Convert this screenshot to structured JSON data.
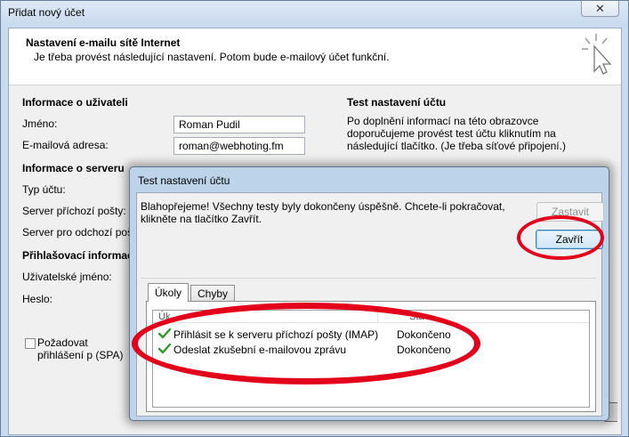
{
  "window": {
    "title": "Přidat nový účet",
    "close_glyph": "✕"
  },
  "header": {
    "title": "Nastavení e-mailu sítě Internet",
    "subtitle": "Je třeba provést následující nastavení. Potom bude e-mailový účet funkční.",
    "icon": "cursor-click-icon"
  },
  "user_info": {
    "heading": "Informace o uživateli",
    "name_label": "Jméno:",
    "name_value": "Roman Pudil",
    "email_label": "E-mailová adresa:",
    "email_value": "roman@webhoting.fm"
  },
  "server_info": {
    "heading": "Informace o serveru",
    "account_type_label": "Typ účtu:",
    "incoming_label": "Server příchozí pošty:",
    "outgoing_label": "Server pro odchozí poštu"
  },
  "login_info": {
    "heading": "Přihlašovací informac",
    "username_label": "Uživatelské jméno:",
    "password_label": "Heslo:",
    "spa_label": "Požadovat přihlášení p (SPA)"
  },
  "test_settings": {
    "heading": "Test nastavení účtu",
    "text": "Po doplnění informací na této obrazovce doporučujeme provést test účtu kliknutím na následující tlačítko. (Je třeba síťové připojení.)"
  },
  "dialog": {
    "title": "Test nastavení účtu",
    "message": "Blahopřejeme! Všechny testy byly dokončeny úspěšně. Chcete-li pokračovat, klikněte na tlačítko Zavřít.",
    "stop_button": "Zastavit",
    "close_button": "Zavřít",
    "tabs": [
      {
        "label": "Úkoly",
        "active": true
      },
      {
        "label": "Chyby",
        "active": false
      }
    ],
    "columns": [
      "Úk",
      "Sta"
    ],
    "rows": [
      {
        "task": "Přihlásit se k serveru příchozí pošty (IMAP)",
        "status": "Dokončeno",
        "icon": "checkmark-icon"
      },
      {
        "task": "Odeslat zkušební e-mailovou zprávu",
        "status": "Dokončeno",
        "icon": "checkmark-icon"
      }
    ]
  },
  "annotation_color": "#e3001b",
  "accent_color": "#3c7fb1"
}
